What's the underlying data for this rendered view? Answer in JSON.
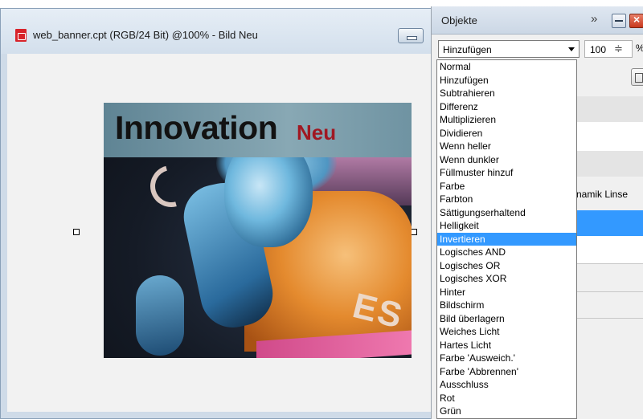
{
  "document": {
    "title": "web_banner.cpt (RGB/24 Bit) @100% - Bild Neu"
  },
  "banner": {
    "title": "Innovation",
    "subtitle": "Neu",
    "shirt_text": "ES"
  },
  "panel": {
    "title": "Objekte",
    "more": "»",
    "blend_mode": "Hinzufügen",
    "opacity_value": "100",
    "opacity_spin": "≑",
    "opacity_unit": "%",
    "object_label": "namik Linse"
  },
  "dropdown": {
    "items": [
      "Normal",
      "Hinzufügen",
      "Subtrahieren",
      "Differenz",
      "Multiplizieren",
      "Dividieren",
      "Wenn heller",
      "Wenn dunkler",
      "Füllmuster hinzuf",
      "Farbe",
      "Farbton",
      "Sättigungserhaltend",
      "Helligkeit",
      "Invertieren",
      "Logisches AND",
      "Logisches OR",
      "Logisches XOR",
      "Hinter",
      "Bildschirm",
      "Bild überlagern",
      "Weiches Licht",
      "Hartes Licht",
      "Farbe 'Ausweich.'",
      "Farbe 'Abbrennen'",
      "Ausschluss",
      "Rot",
      "Grün"
    ],
    "selected_index": 13
  },
  "colors": {
    "selection": "#3399ff",
    "accent_red": "#a01822"
  }
}
